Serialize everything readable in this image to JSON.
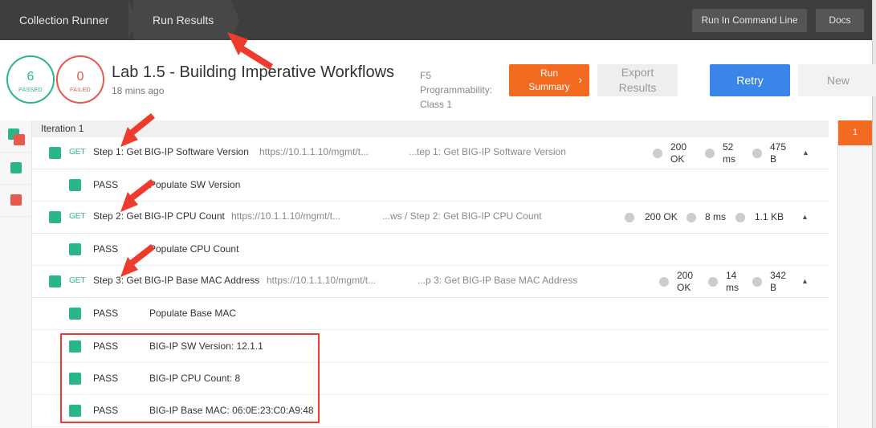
{
  "breadcrumb": {
    "first": "Collection Runner",
    "second": "Run Results"
  },
  "toolbar": {
    "run_command_line": "Run In Command Line",
    "docs": "Docs"
  },
  "summary": {
    "passed_count": "6",
    "passed_label": "PASSED",
    "failed_count": "0",
    "failed_label": "FAILED",
    "title": "Lab 1.5 - Building Imperative Workflows",
    "time_ago": "18 mins ago",
    "collection_line1": "F5",
    "collection_line2": "Programmability:",
    "collection_line3": "Class 1",
    "run_summary_line1": "Run",
    "run_summary_line2": "Summary",
    "export_line1": "Export",
    "export_line2": "Results",
    "retry": "Retry",
    "new": "New"
  },
  "right_tab": "1",
  "iteration": "Iteration 1",
  "requests": [
    {
      "method": "GET",
      "name": "Step 1: Get BIG-IP Software Version",
      "url": "https://10.1.1.10/mgmt/t...",
      "path": "...tep 1: Get BIG-IP Software Version",
      "status_line1": "200",
      "status_line2": "OK",
      "time_line1": "52",
      "time_line2": "ms",
      "size_line1": "475",
      "size_line2": "B",
      "tests": [
        {
          "status": "PASS",
          "name": "Populate SW Version"
        }
      ]
    },
    {
      "method": "GET",
      "name": "Step 2: Get BIG-IP CPU Count",
      "url": "https://10.1.1.10/mgmt/t...",
      "path": "...ws / Step 2: Get BIG-IP CPU Count",
      "status": "200 OK",
      "time": "8 ms",
      "size": "1.1 KB",
      "tests": [
        {
          "status": "PASS",
          "name": "Populate CPU Count"
        }
      ]
    },
    {
      "method": "GET",
      "name": "Step 3: Get BIG-IP Base MAC Address",
      "url": "https://10.1.1.10/mgmt/t...",
      "path": "...p 3: Get BIG-IP Base MAC Address",
      "status_line1": "200",
      "status_line2": "OK",
      "time_line1": "14",
      "time_line2": "ms",
      "size_line1": "342",
      "size_line2": "B",
      "tests": [
        {
          "status": "PASS",
          "name": "Populate Base MAC"
        },
        {
          "status": "PASS",
          "name": "BIG-IP SW Version: 12.1.1"
        },
        {
          "status": "PASS",
          "name": "BIG-IP CPU Count: 8"
        },
        {
          "status": "PASS",
          "name": "BIG-IP Base MAC: 06:0E:23:C0:A9:48"
        }
      ]
    }
  ],
  "colors": {
    "pass": "#2bb58d",
    "fail": "#e8584c",
    "accent": "#f26b21",
    "primary": "#3a86e8",
    "annotation": "#ee3b2b"
  }
}
